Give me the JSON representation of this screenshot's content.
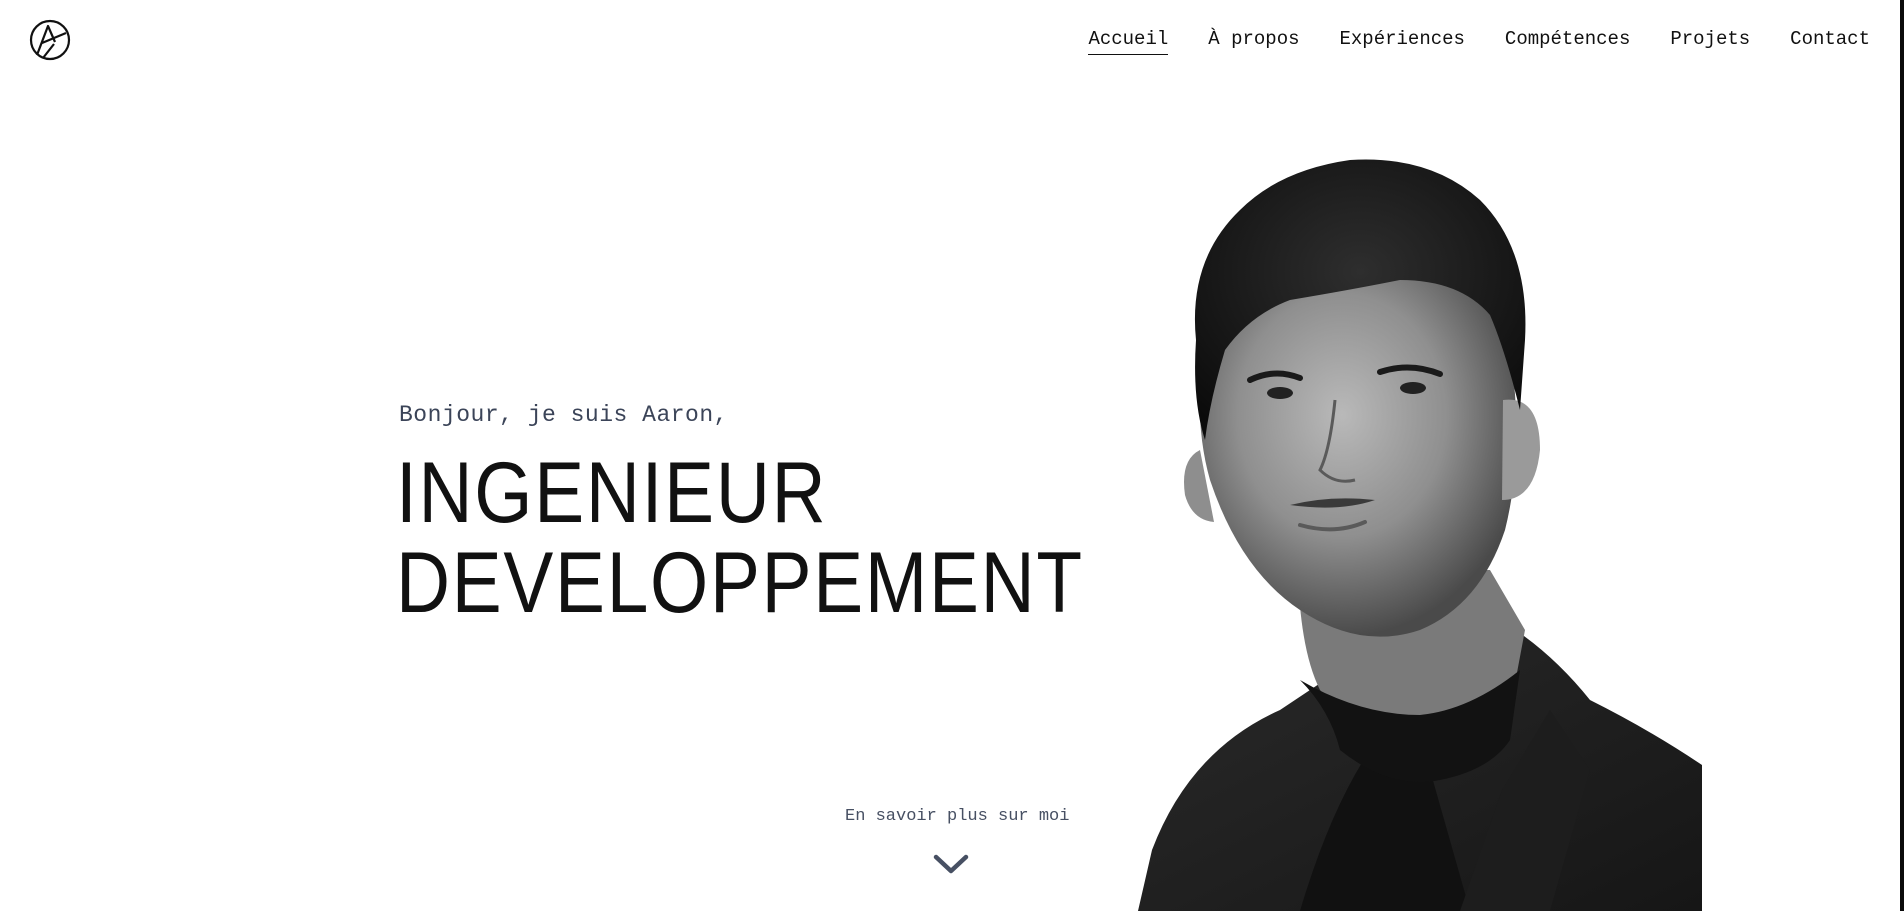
{
  "header": {
    "logo_icon": "ab-monogram-logo-icon",
    "nav": [
      {
        "label": "Accueil",
        "active": true
      },
      {
        "label": "À propos",
        "active": false
      },
      {
        "label": "Expériences",
        "active": false
      },
      {
        "label": "Compétences",
        "active": false
      },
      {
        "label": "Projets",
        "active": false
      },
      {
        "label": "Contact",
        "active": false
      }
    ]
  },
  "hero": {
    "greeting": "Bonjour, je suis Aaron,",
    "title_line1": "INGENIEUR",
    "title_line2": "DEVELOPPEMENT",
    "cta_label": "En savoir plus sur moi",
    "cta_icon": "chevron-down-icon",
    "portrait": "black-and-white-portrait-photo"
  },
  "colors": {
    "background": "#ffffff",
    "text": "#111111",
    "muted_text": "#3b4458",
    "accent_slate": "#475063"
  }
}
